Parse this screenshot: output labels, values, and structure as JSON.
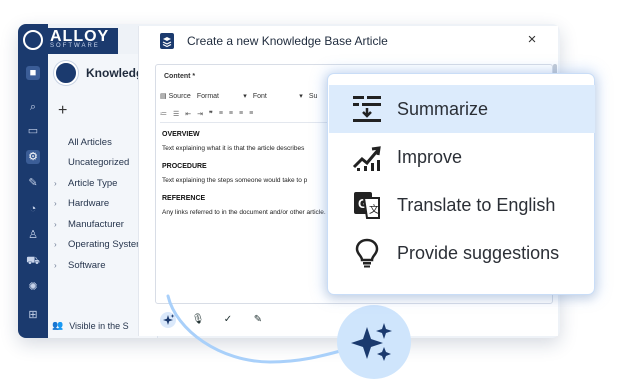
{
  "app": {
    "brand": "ALLOY",
    "brand_sub": "SOFTWARE",
    "kb_title": "Knowledge",
    "add_label": "+",
    "nav": [
      {
        "label": "All Articles",
        "chevron": false
      },
      {
        "label": "Uncategorized",
        "chevron": false
      },
      {
        "label": "Article Type",
        "chevron": true
      },
      {
        "label": "Hardware",
        "chevron": true
      },
      {
        "label": "Manufacturer",
        "chevron": true
      },
      {
        "label": "Operating System",
        "chevron": true
      },
      {
        "label": "Software",
        "chevron": true
      }
    ],
    "visible_in": "Visible in the S"
  },
  "modal": {
    "title": "Create a new Knowledge Base Article",
    "close_label": "×",
    "content_label": "Content *",
    "toolbar": {
      "source": "Source",
      "format": "Format",
      "font": "Font",
      "size": "Su"
    },
    "sections": [
      {
        "heading": "OVERVIEW",
        "text": "Text explaining what it is that the article describes"
      },
      {
        "heading": "PROCEDURE",
        "text": "Text explaining the steps someone would take to p"
      },
      {
        "heading": "REFERENCE",
        "text": "Any links referred to in the document and/or other article."
      }
    ]
  },
  "menu": {
    "items": [
      {
        "label": "Summarize",
        "icon": "summarize-icon",
        "highlighted": true
      },
      {
        "label": "Improve",
        "icon": "improve-icon",
        "highlighted": false
      },
      {
        "label": "Translate to English",
        "icon": "translate-icon",
        "highlighted": false
      },
      {
        "label": "Provide suggestions",
        "icon": "lightbulb-icon",
        "highlighted": false
      }
    ]
  },
  "colors": {
    "brand": "#1b3a6e",
    "highlight": "#dcebfc",
    "connector": "#a9d0fa"
  }
}
